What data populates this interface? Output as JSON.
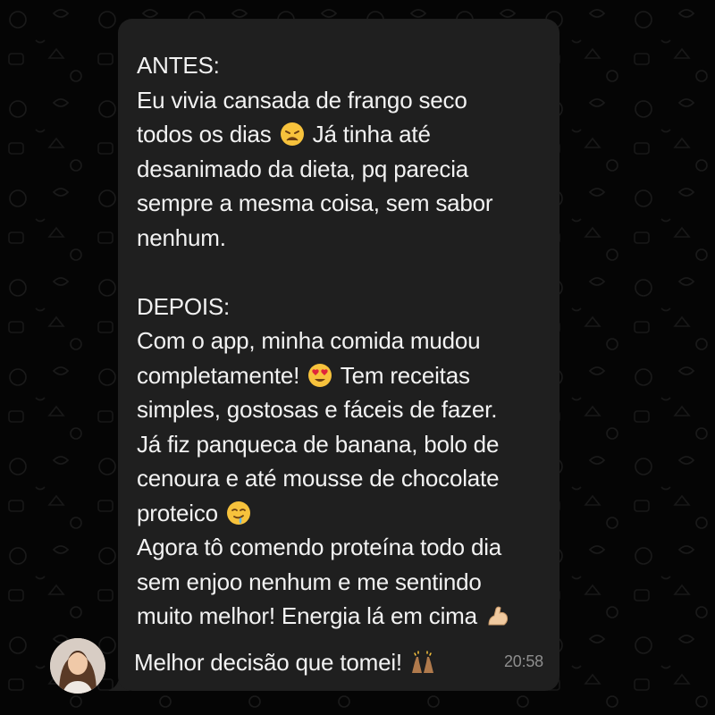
{
  "chat": {
    "message": {
      "before_heading": "ANTES:",
      "before_lines": [
        "Eu vivia cansada de frango seco",
        "todos os dias",
        "Já tinha até",
        "desanimado da dieta, pq parecia",
        "sempre a mesma coisa, sem sabor",
        "nenhum."
      ],
      "after_heading": "DEPOIS:",
      "after_lines": [
        "Com o app, minha comida mudou",
        "completamente!",
        "Tem receitas",
        "simples, gostosas e fáceis de fazer.",
        "Já fiz panqueca de banana, bolo de",
        "cenoura e até mousse de chocolate",
        "proteico",
        "Agora tô comendo proteína todo dia",
        "sem enjoo nenhum e me sentindo",
        "muito melhor! Energia lá em cima"
      ],
      "closing_line": "Melhor decisão que tomei!",
      "timestamp": "20:58"
    },
    "emojis": [
      "weary-face",
      "heart-eyes-face",
      "drooling-face",
      "flexed-biceps",
      "raising-hands"
    ]
  },
  "colors": {
    "background": "#000000",
    "bubble": "#1f1f1f",
    "text": "#f2f2f2",
    "timestamp": "#8e8e8e"
  }
}
